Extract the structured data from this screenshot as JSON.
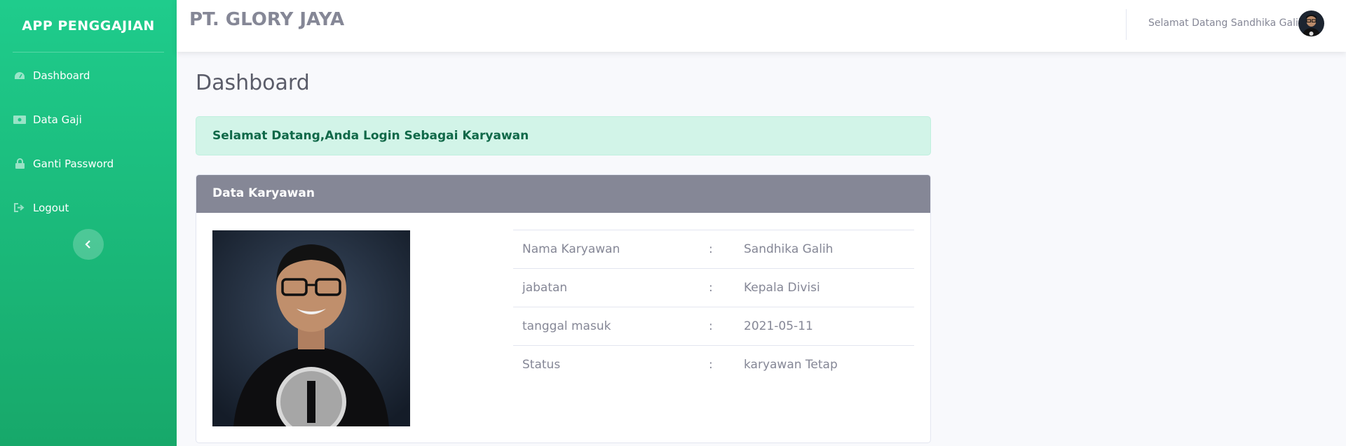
{
  "sidebar": {
    "brand": "APP PENGGAJIAN",
    "items": [
      {
        "label": "Dashboard",
        "icon": "tachometer-icon"
      },
      {
        "label": "Data Gaji",
        "icon": "money-icon"
      },
      {
        "label": "Ganti Password",
        "icon": "lock-icon"
      },
      {
        "label": "Logout",
        "icon": "sign-out-icon"
      }
    ],
    "toggle_icon": "chevron-left-icon"
  },
  "topbar": {
    "company": "PT. GLORY JAYA",
    "welcome": "Selamat Datang Sandhika Galih"
  },
  "main": {
    "title": "Dashboard",
    "alert": "Selamat Datang,Anda Login Sebagai Karyawan",
    "card_title": "Data Karyawan",
    "rows": [
      {
        "label": "Nama Karyawan",
        "sep": ":",
        "value": "Sandhika Galih"
      },
      {
        "label": "jabatan",
        "sep": ":",
        "value": "Kepala Divisi"
      },
      {
        "label": "tanggal masuk",
        "sep": ":",
        "value": "2021-05-11"
      },
      {
        "label": "Status",
        "sep": ":",
        "value": "karyawan Tetap"
      }
    ]
  },
  "colors": {
    "sidebar_top": "#1fcc8c",
    "sidebar_bottom": "#17a86a",
    "card_header": "#858796",
    "alert_bg": "#d2f4e8",
    "alert_text": "#0f6848"
  }
}
